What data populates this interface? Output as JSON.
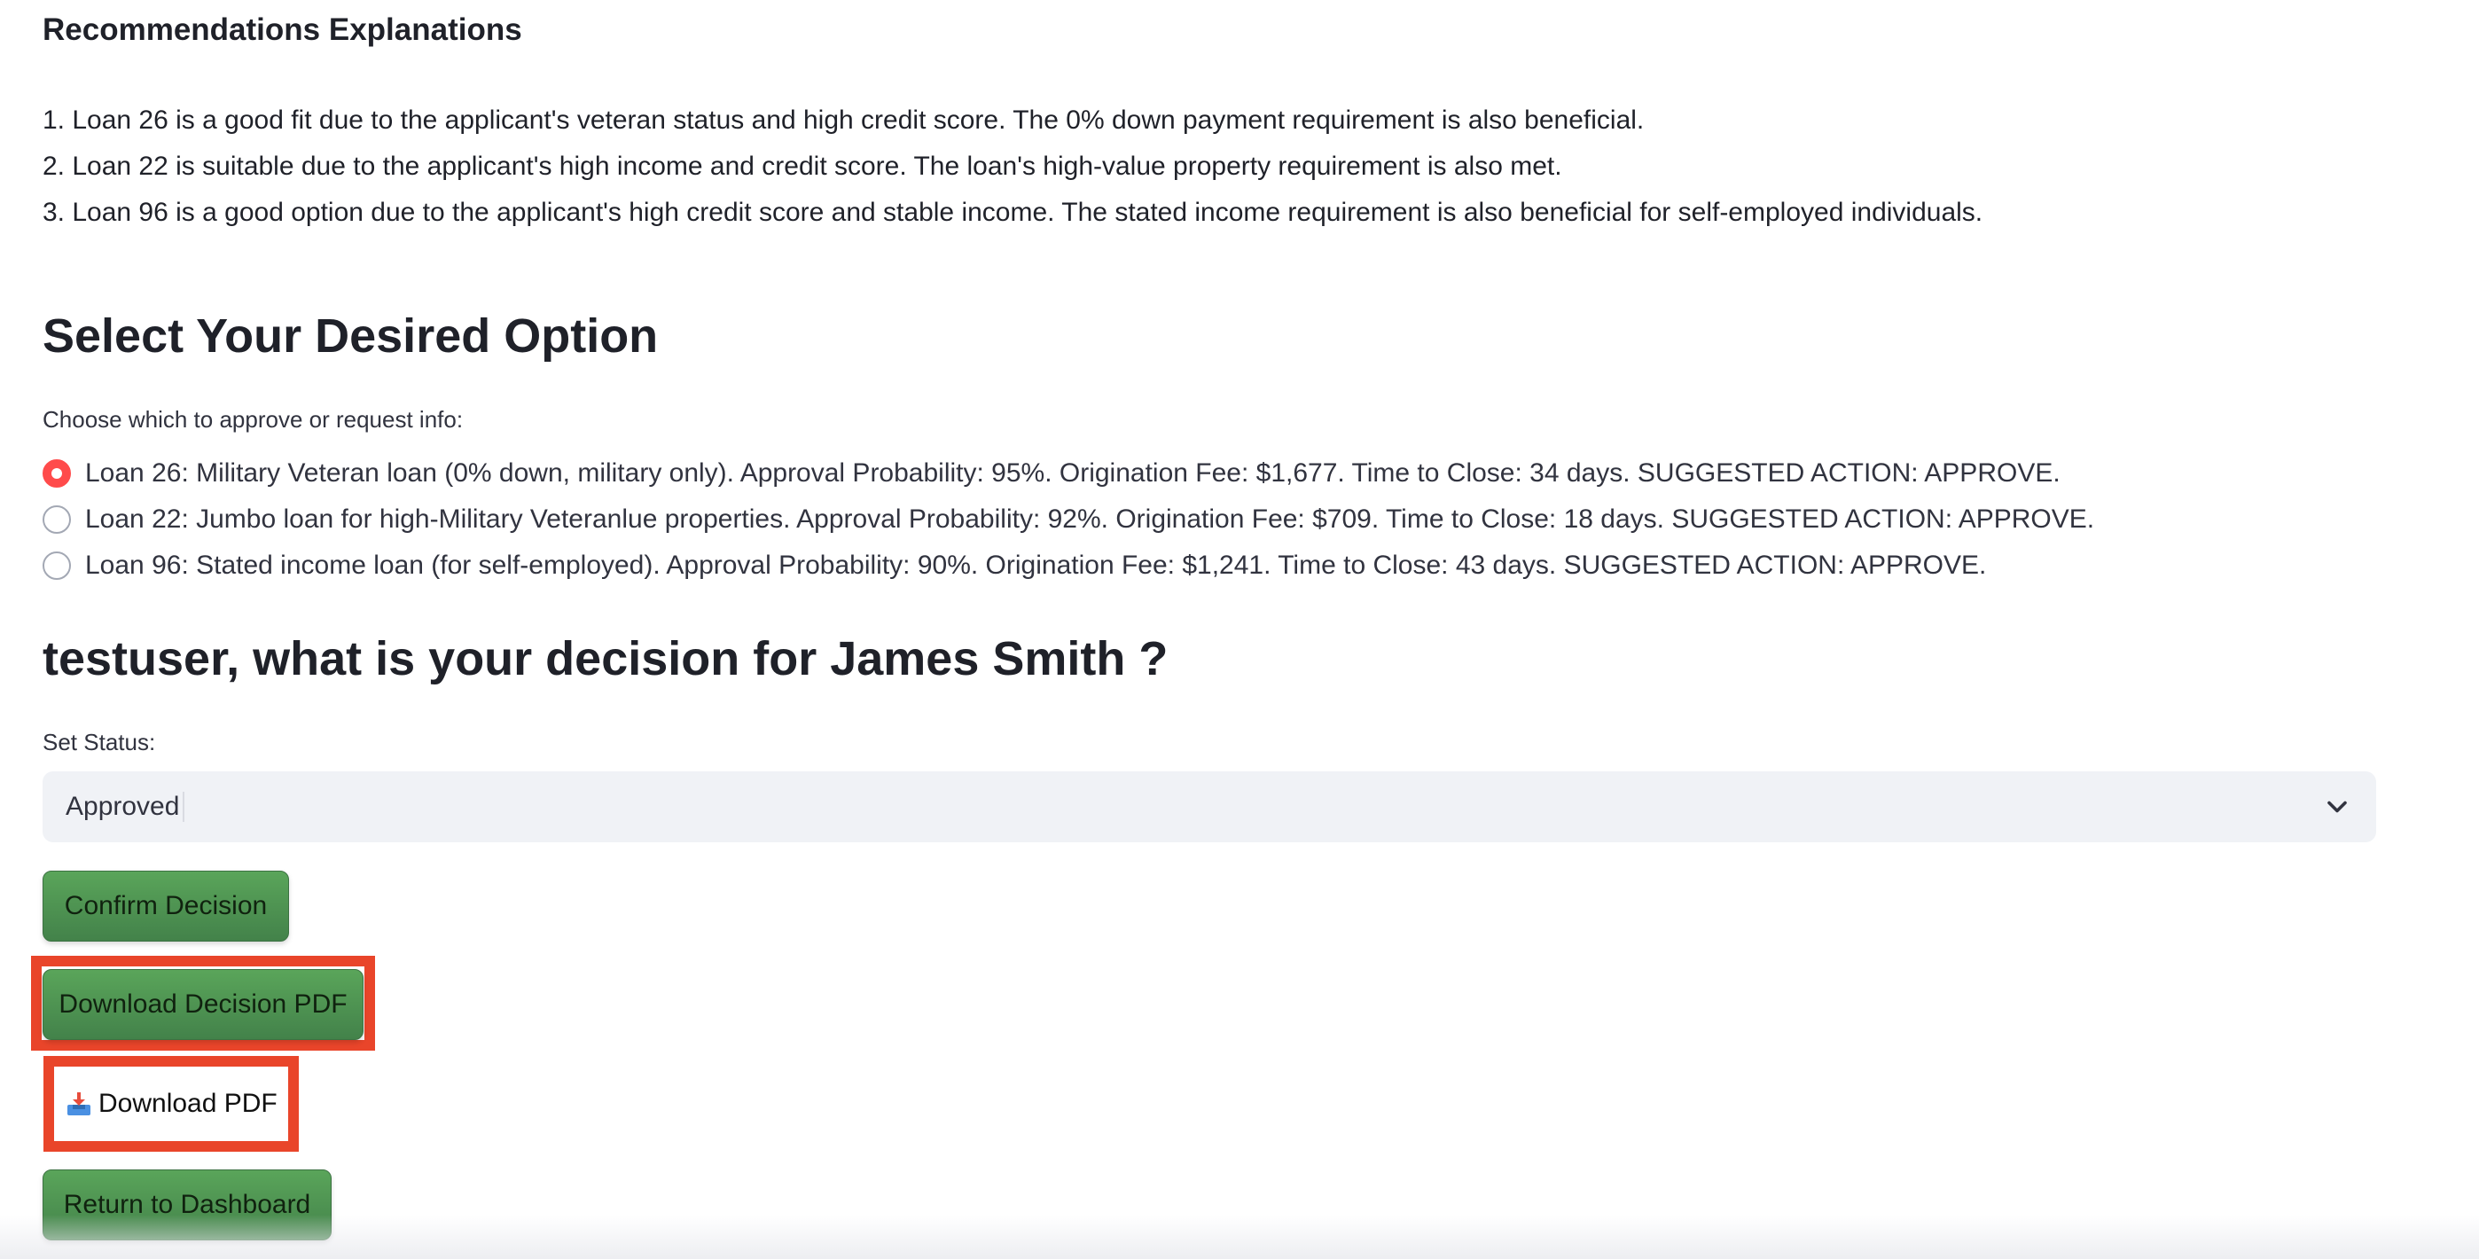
{
  "recommendations": {
    "heading": "Recommendations Explanations",
    "items": [
      "1. Loan 26 is a good fit due to the applicant's veteran status and high credit score. The 0% down payment requirement is also beneficial.",
      "2. Loan 22 is suitable due to the applicant's high income and credit score. The loan's high-value property requirement is also met.",
      "3. Loan 96 is a good option due to the applicant's high credit score and stable income. The stated income requirement is also beneficial for self-employed individuals."
    ]
  },
  "select_option": {
    "title": "Select Your Desired Option",
    "label": "Choose which to approve or request info:",
    "options": [
      {
        "label": "Loan 26: Military Veteran loan (0% down, military only). Approval Probability: 95%. Origination Fee: $1,677. Time to Close: 34 days. SUGGESTED ACTION: APPROVE.",
        "selected": true
      },
      {
        "label": "Loan 22: Jumbo loan for high-Military Veteranlue properties. Approval Probability: 92%. Origination Fee: $709. Time to Close: 18 days. SUGGESTED ACTION: APPROVE.",
        "selected": false
      },
      {
        "label": "Loan 96: Stated income loan (for self-employed). Approval Probability: 90%. Origination Fee: $1,241. Time to Close: 43 days. SUGGESTED ACTION: APPROVE.",
        "selected": false
      }
    ]
  },
  "decision": {
    "title": "testuser, what is your decision for James Smith ?",
    "status_label": "Set Status:",
    "status_value": "Approved",
    "confirm_label": "Confirm Decision",
    "download_decision_label": "Download Decision PDF",
    "download_pdf_label": "Download PDF",
    "return_label": "Return to Dashboard"
  },
  "colors": {
    "accent_radio": "#ff4b4b",
    "button_green": "#4f9452",
    "highlight_red": "#e9452a",
    "select_bg": "#f0f2f6"
  },
  "icons": {
    "selectbox": "chevron-down-icon",
    "download_pdf": "inbox-tray-icon"
  }
}
